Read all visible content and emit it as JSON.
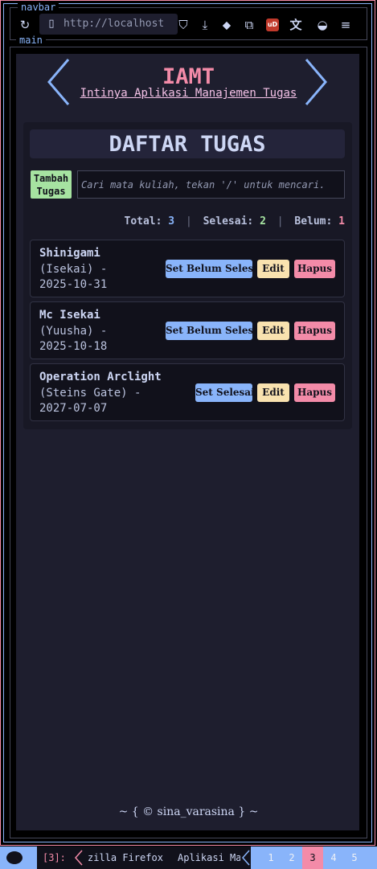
{
  "labels": {
    "navbar": "navbar",
    "main": "main"
  },
  "browser": {
    "url": "http://localhost",
    "icons": [
      "reload-icon",
      "page-icon",
      "pocket-icon",
      "download-icon",
      "extension-icon",
      "puzzle-icon",
      "ublock-icon",
      "translate-icon",
      "vpn-icon",
      "menu-icon"
    ],
    "ublock_badge": "uD"
  },
  "app": {
    "title": "IAMT",
    "subtitle": "Intinya Aplikasi Manajemen Tugas",
    "list_heading": "DAFTAR TUGAS",
    "add_button": "Tambah\nTugas",
    "search_placeholder": "Cari mata kuliah, tekan '/' untuk mencari.",
    "stats": {
      "total_label": "Total:",
      "total": "3",
      "done_label": "Selesai:",
      "done": "2",
      "todo_label": "Belum:",
      "todo": "1",
      "separator": "|"
    },
    "tasks": [
      {
        "name": "Shinigami",
        "category": "(Isekai) -",
        "date": "2025-10-31",
        "toggle_label": "Set Belum Selesai",
        "edit_label": "Edit",
        "delete_label": "Hapus"
      },
      {
        "name": "Mc Isekai",
        "category": "(Yuusha) -",
        "date": "2025-10-18",
        "toggle_label": "Set Belum Selesai",
        "edit_label": "Edit",
        "delete_label": "Hapus"
      },
      {
        "name": "Operation Arclight",
        "category": "(Steins Gate) -",
        "date": "2027-07-07",
        "toggle_label": "Set Selesai",
        "edit_label": "Edit",
        "delete_label": "Hapus"
      }
    ],
    "footer": "~ { © sina_varasina } ~"
  },
  "taskbar": {
    "workspace": "[3]:",
    "window_1": "zilla Firefox",
    "window_2": "Aplikasi Ma",
    "tags": [
      "1",
      "2",
      "3",
      "4",
      "5"
    ],
    "active_tag": "3"
  },
  "colors": {
    "accent_pink": "#f38ba8",
    "accent_blue": "#89b4fa",
    "accent_green": "#a6e3a1",
    "accent_yellow": "#f9e2af",
    "background": "#1e1e2e"
  }
}
